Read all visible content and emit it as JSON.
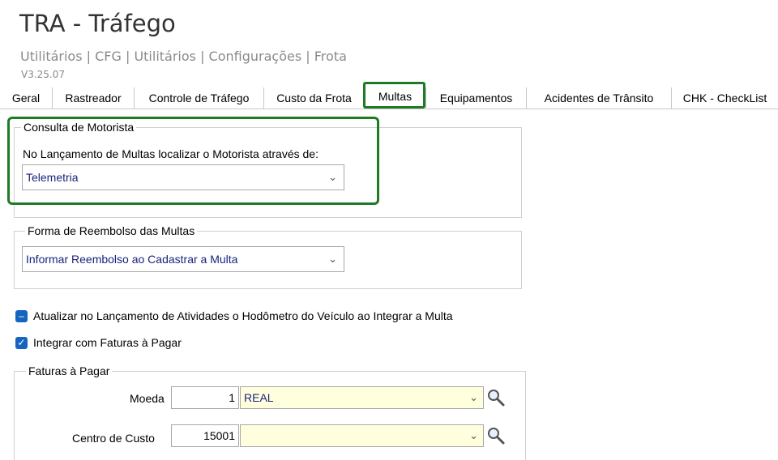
{
  "header": {
    "title": "TRA - Tráfego",
    "breadcrumb": "Utilitários | CFG | Utilitários | Configurações | Frota",
    "version": "V3.25.07"
  },
  "tabs": [
    {
      "label": "Geral"
    },
    {
      "label": "Rastreador"
    },
    {
      "label": "Controle de Tráfego"
    },
    {
      "label": "Custo da Frota"
    },
    {
      "label": "Multas"
    },
    {
      "label": "Equipamentos"
    },
    {
      "label": "Acidentes de Trânsito"
    },
    {
      "label": "CHK - CheckList"
    }
  ],
  "active_tab": "Multas",
  "consulta": {
    "legend": "Consulta de Motorista",
    "label": "No Lançamento de Multas localizar o Motorista através de:",
    "selected": "Telemetria"
  },
  "reembolso": {
    "legend": "Forma de Reembolso das Multas",
    "selected": "Informar Reembolso ao Cadastrar a Multa"
  },
  "options": {
    "atualizar_label": "Atualizar no Lançamento de Atividades o Hodômetro do Veículo ao Integrar a Multa",
    "integrar_label": "Integrar com Faturas à Pagar"
  },
  "faturas": {
    "legend": "Faturas à Pagar",
    "moeda_label": "Moeda",
    "moeda_code": "1",
    "moeda_name": "REAL",
    "centro_label": "Centro de Custo",
    "centro_code": "15001",
    "centro_name": ""
  },
  "colors": {
    "accent": "#1565c0",
    "highlight": "#1f7a25",
    "lookup_bg": "#ffffdd"
  }
}
